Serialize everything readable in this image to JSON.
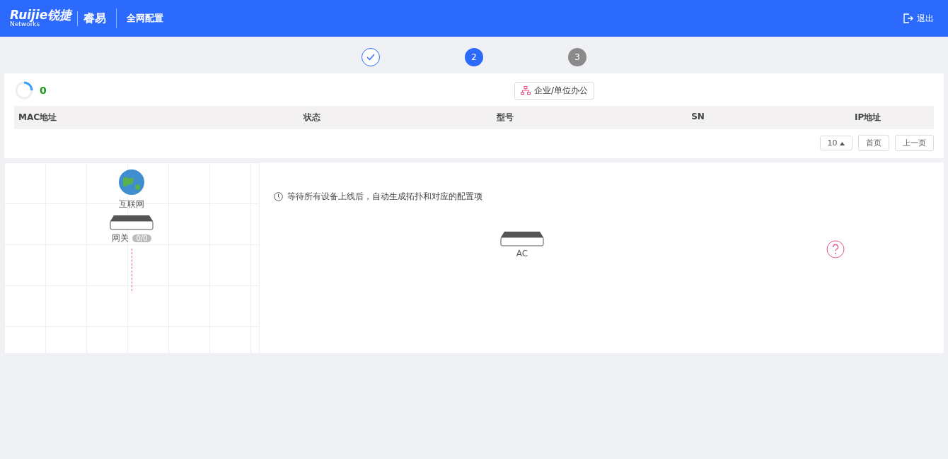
{
  "header": {
    "brand": "Ruijie锐捷",
    "brand_sub": "Networks",
    "product": "睿易",
    "title": "全网配置",
    "logout": "退出"
  },
  "steps": [
    {
      "done": true,
      "selected": false
    },
    {
      "number": "2",
      "done": false,
      "selected": true
    },
    {
      "number": "3",
      "done": false,
      "selected": false
    }
  ],
  "scene": {
    "label": "企业/单位办公"
  },
  "status": {
    "count": "0"
  },
  "table": {
    "columns": [
      "MAC地址",
      "状态",
      "型号",
      "SN",
      "IP地址"
    ]
  },
  "pagination": {
    "page_size": "10",
    "first": "首页",
    "prev": "上一页"
  },
  "topology": {
    "internet": "互联网",
    "gateway": {
      "label": "网关",
      "badge": "0/0"
    },
    "ac": {
      "label": "AC"
    }
  },
  "notice": "等待所有设备上线后，自动生成拓扑和对应的配置项"
}
